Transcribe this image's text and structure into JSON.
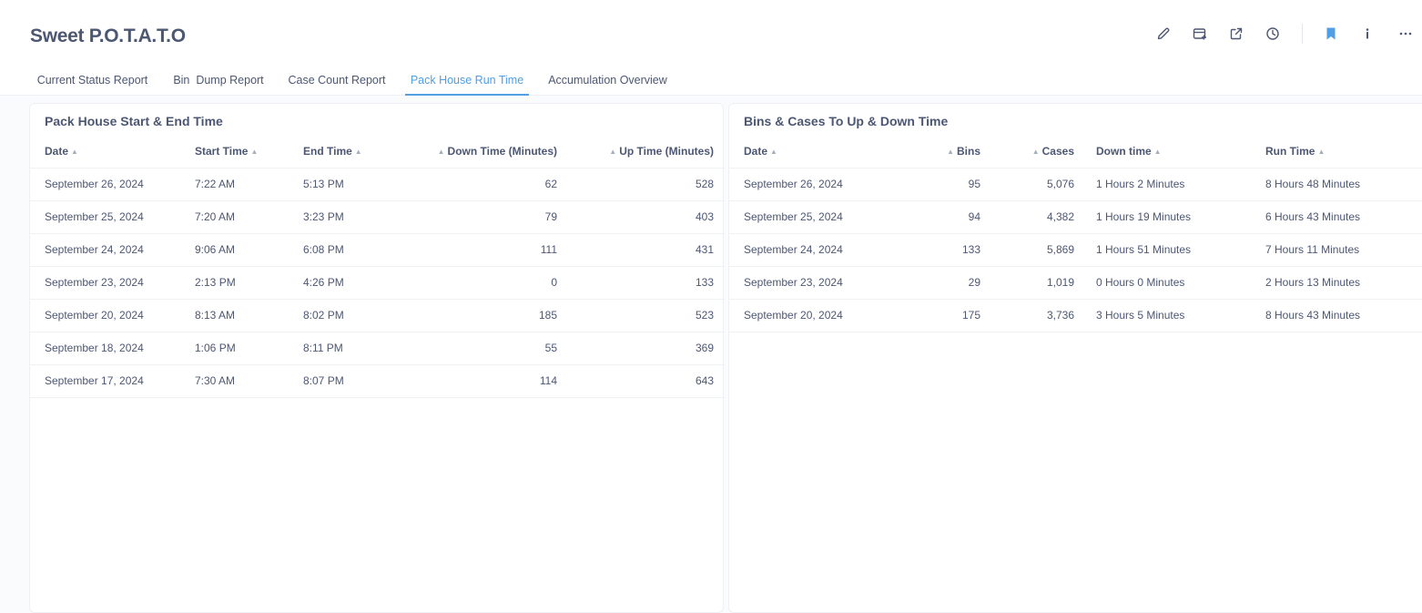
{
  "app": {
    "title": "Sweet P.O.T.A.T.O"
  },
  "toolbar": {
    "icons": [
      "pencil-icon",
      "add-to-dashboard-icon",
      "share-icon",
      "history-icon",
      "bookmark-icon",
      "info-icon",
      "more-icon"
    ],
    "accent": "#509ee3"
  },
  "tabs": [
    {
      "label": "Current Status Report"
    },
    {
      "label": "Bin  Dump Report"
    },
    {
      "label": "Case Count Report"
    },
    {
      "label": "Pack House Run Time",
      "active": true
    },
    {
      "label": "Accumulation Overview"
    }
  ],
  "left": {
    "title": "Pack House Start & End Time",
    "columns": [
      "Date",
      "Start Time",
      "End Time",
      "Down Time (Minutes)",
      "Up Time (Minutes)"
    ],
    "rows": [
      [
        "September 26, 2024",
        "7:22 AM",
        "5:13 PM",
        "62",
        "528"
      ],
      [
        "September 25, 2024",
        "7:20 AM",
        "3:23 PM",
        "79",
        "403"
      ],
      [
        "September 24, 2024",
        "9:06 AM",
        "6:08 PM",
        "111",
        "431"
      ],
      [
        "September 23, 2024",
        "2:13 PM",
        "4:26 PM",
        "0",
        "133"
      ],
      [
        "September 20, 2024",
        "8:13 AM",
        "8:02 PM",
        "185",
        "523"
      ],
      [
        "September 18, 2024",
        "1:06 PM",
        "8:11 PM",
        "55",
        "369"
      ],
      [
        "September 17, 2024",
        "7:30 AM",
        "8:07 PM",
        "114",
        "643"
      ]
    ]
  },
  "right": {
    "title": "Bins & Cases To Up & Down Time",
    "columns": [
      "Date",
      "Bins",
      "Cases",
      "Down time",
      "Run Time"
    ],
    "rows": [
      [
        "September 26, 2024",
        "95",
        "5,076",
        "1 Hours 2 Minutes",
        "8 Hours 48 Minutes"
      ],
      [
        "September 25, 2024",
        "94",
        "4,382",
        "1 Hours 19 Minutes",
        "6 Hours 43 Minutes"
      ],
      [
        "September 24, 2024",
        "133",
        "5,869",
        "1 Hours 51 Minutes",
        "7 Hours 11 Minutes"
      ],
      [
        "September 23, 2024",
        "29",
        "1,019",
        "0 Hours 0 Minutes",
        "2 Hours 13 Minutes"
      ],
      [
        "September 20, 2024",
        "175",
        "3,736",
        "3 Hours 5 Minutes",
        "8 Hours 43 Minutes"
      ]
    ]
  }
}
